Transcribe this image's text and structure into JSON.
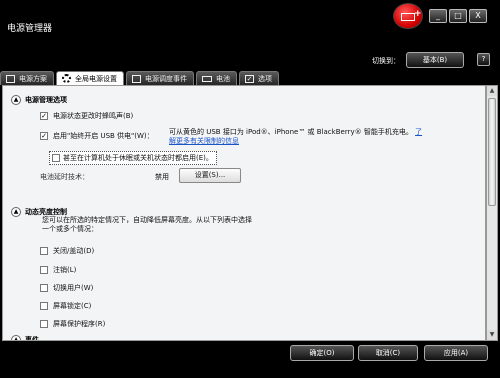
{
  "window": {
    "title": "电源管理器",
    "logo_icon": "battery-plus-icon",
    "minimize": "_",
    "maximize": "□",
    "close": "X"
  },
  "toolbar": {
    "switch_label": "切换到：",
    "switch_button": "基本(B)",
    "help_button": "?"
  },
  "tabs": [
    {
      "label": "电源方案",
      "icon": "box-icon",
      "active": false
    },
    {
      "label": "全局电源设置",
      "icon": "gear-icon",
      "active": true
    },
    {
      "label": "电源调度事件",
      "icon": "calendar-icon",
      "active": false
    },
    {
      "label": "电池",
      "icon": "battery-icon",
      "active": false
    },
    {
      "label": "选项",
      "icon": "checkbox-icon",
      "active": false
    }
  ],
  "sections": {
    "power_options": {
      "title": "电源管理选项",
      "beep_checkbox": {
        "label": "电源状态更改时蜂鸣声(B)",
        "checked": true
      },
      "usb_checkbox": {
        "label": "启用\"始终开启 USB 供电\"(W)：",
        "checked": true
      },
      "usb_info": "可从黄色的 USB 接口为 iPod®、iPhone™ 或 BlackBerry® 智能手机充电。",
      "usb_link": "了解更多有关限制的信息",
      "usb_sub_checkbox": {
        "label": "甚至在计算机处于休眠或关机状态时都启用(E)。",
        "checked": false
      },
      "battery_delay_label": "电池延时技术：",
      "battery_delay_value": "禁用",
      "settings_button": "设置(S)..."
    },
    "dynamic_brightness": {
      "title": "动态亮度控制",
      "description": "您可以在所选的特定情况下，自动降低屏幕亮度。从以下列表中选择一个或多个情况：",
      "options": [
        {
          "label": "关闭/盖动(D)",
          "checked": false
        },
        {
          "label": "注销(L)",
          "checked": false
        },
        {
          "label": "切换用户(W)",
          "checked": false
        },
        {
          "label": "屏幕锁定(C)",
          "checked": false
        },
        {
          "label": "屏幕保护程序(R)",
          "checked": false
        }
      ]
    },
    "events": {
      "title": "事件"
    }
  },
  "footer": {
    "ok": "确定(O)",
    "cancel": "取消(C)",
    "apply": "应用(A)"
  }
}
